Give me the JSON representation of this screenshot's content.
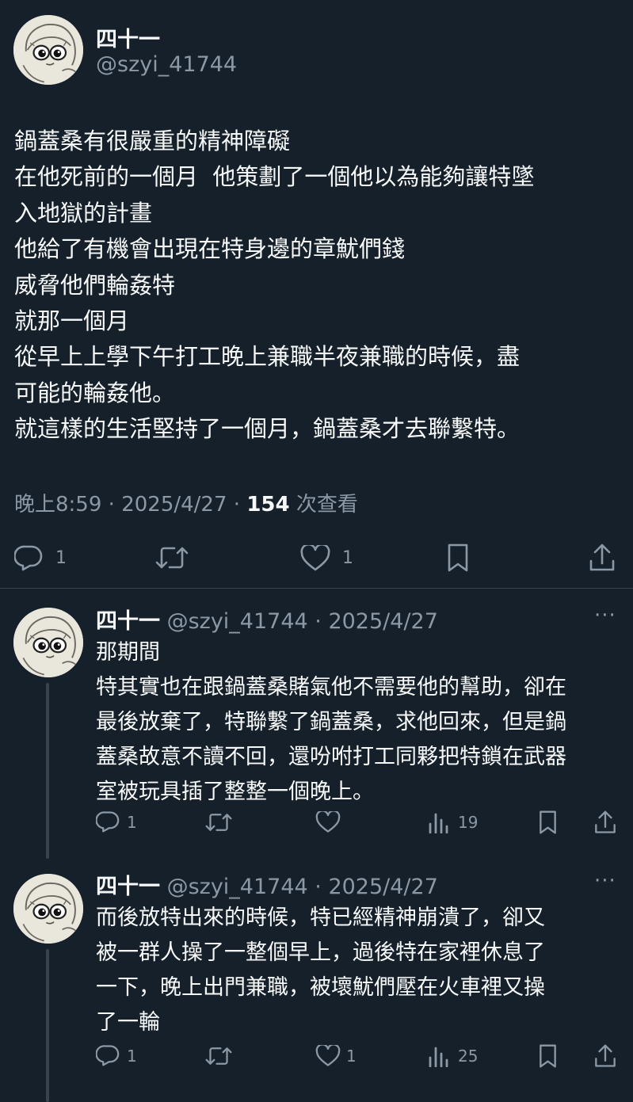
{
  "main_tweet": {
    "author_name": "四十一",
    "handle": "@szyi_41744",
    "body_lines": [
      "鍋蓋桑有很嚴重的精神障礙",
      "在他死前的一個月  他策劃了一個他以為能夠讓特墜",
      "入地獄的計畫",
      "他給了有機會出現在特身邊的章魷們錢",
      "威脅他們輪姦特",
      "就那一個月",
      "從早上上學下午打工晚上兼職半夜兼職的時候，盡",
      "可能的輪姦他。",
      "就這樣的生活堅持了一個月，鍋蓋桑才去聯繫特。"
    ],
    "time": "晚上8:59",
    "sep1": " · ",
    "date": "2025/4/27",
    "sep2": " · ",
    "views": "154",
    "views_label": " 次查看",
    "reply_count": "1",
    "like_count": "1",
    "icons": [
      "reply-icon",
      "retweet-icon",
      "like-icon",
      "bookmark-icon",
      "share-icon"
    ]
  },
  "replies": [
    {
      "author_name": "四十一",
      "handle_date": " @szyi_41744 · 2025/4/27",
      "more": "···",
      "body_lines": [
        "那期間",
        "特其實也在跟鍋蓋桑賭氣他不需要他的幫助，卻在",
        "最後放棄了，特聯繫了鍋蓋桑，求他回來，但是鍋",
        "蓋桑故意不讀不回，還吩咐打工同夥把特鎖在武器",
        "室被玩具插了整整一個晚上。"
      ],
      "reply_count": "1",
      "like_count": "",
      "views": "19"
    },
    {
      "author_name": "四十一",
      "handle_date": " @szyi_41744 · 2025/4/27",
      "more": "···",
      "body_lines": [
        "而後放特出來的時候，特已經精神崩潰了，卻又",
        "被一群人操了一整個早上，過後特在家裡休息了",
        "一下，晚上出門兼職，被壞魷們壓在火車裡又操",
        "了一輪"
      ],
      "reply_count": "1",
      "like_count": "1",
      "views": "25"
    }
  ],
  "colors": {
    "background": "#15202b",
    "text": "#f7f9f9",
    "secondary": "#8b98a5",
    "divider": "#38444d"
  }
}
